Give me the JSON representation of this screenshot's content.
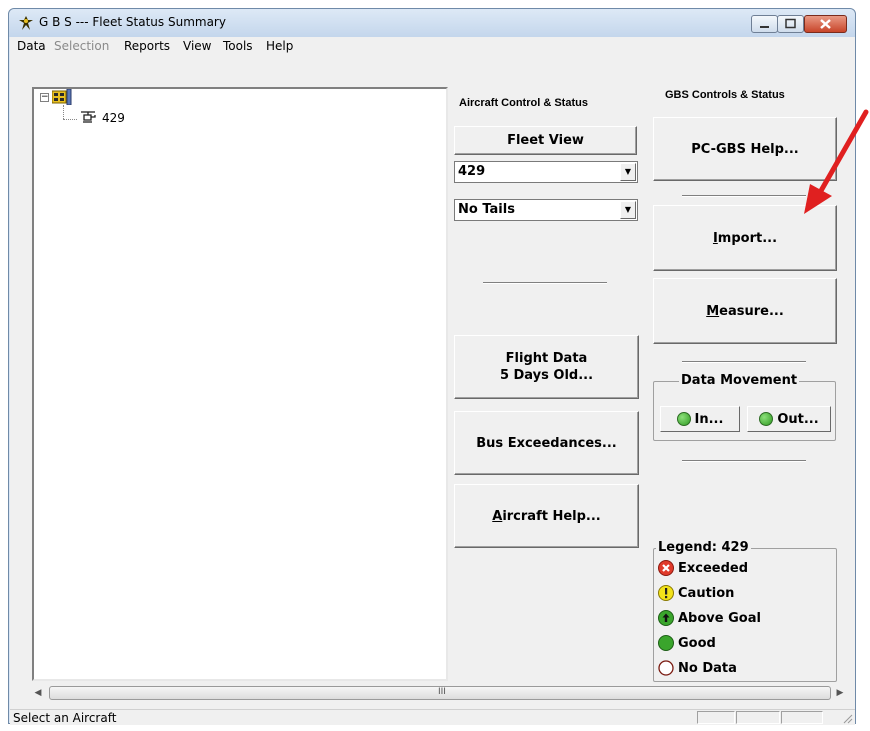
{
  "window": {
    "title": "G B S --- Fleet Status Summary"
  },
  "menu": {
    "items": [
      {
        "label": "Data",
        "disabled": false
      },
      {
        "label": "Selection",
        "disabled": true
      },
      {
        "label": "Reports",
        "disabled": false
      },
      {
        "label": "View",
        "disabled": false
      },
      {
        "label": "Tools",
        "disabled": false
      },
      {
        "label": "Help",
        "disabled": false
      }
    ]
  },
  "tree": {
    "child_label": "429"
  },
  "aircraft_panel": {
    "title": "Aircraft Control & Status",
    "fleet_view_label": "Fleet View",
    "aircraft_combo_value": "429",
    "tails_combo_value": "No Tails",
    "flight_data_line1": "Flight Data",
    "flight_data_line2": "5 Days Old...",
    "bus_exceedances_label": "Bus Exceedances...",
    "aircraft_help_prefix": "A",
    "aircraft_help_rest": "ircraft Help..."
  },
  "gbs_panel": {
    "title": "GBS Controls & Status",
    "help_label": "PC-GBS Help...",
    "import_prefix": "I",
    "import_rest": "mport...",
    "measure_prefix": "M",
    "measure_rest": "easure...",
    "data_movement": {
      "title": "Data Movement",
      "in_label": "In...",
      "out_label": "Out..."
    }
  },
  "legend": {
    "title": "Legend: 429",
    "items": [
      {
        "label": "Exceeded",
        "icon": "exceeded-icon",
        "color": "#e03a2a"
      },
      {
        "label": "Caution",
        "icon": "caution-icon",
        "color": "#f2e21a"
      },
      {
        "label": "Above Goal",
        "icon": "above-goal-icon",
        "color": "#3aa52c"
      },
      {
        "label": "Good",
        "icon": "good-icon",
        "color": "#3aa52c"
      },
      {
        "label": "No Data",
        "icon": "no-data-icon",
        "color": "#ffffff"
      }
    ]
  },
  "statusbar": {
    "text": "Select an Aircraft"
  },
  "hscroll": {
    "grip": "III"
  },
  "annotation": {
    "arrow_color": "#e02020"
  }
}
